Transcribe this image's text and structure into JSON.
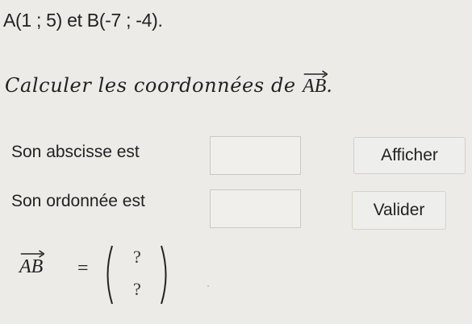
{
  "given": {
    "text": "A(1 ; 5) et B(-7 ; -4)."
  },
  "instruction": {
    "text": "Calculer les coordonnées de ",
    "vector": "AB",
    "end": "."
  },
  "abscisse": {
    "label": "Son abscisse est",
    "value": ""
  },
  "ordonnee": {
    "label": "Son ordonnée est",
    "value": ""
  },
  "buttons": {
    "afficher": "Afficher",
    "valider": "Valider"
  },
  "result": {
    "vector": "AB",
    "equals": "=",
    "x": "?",
    "y": "?"
  }
}
